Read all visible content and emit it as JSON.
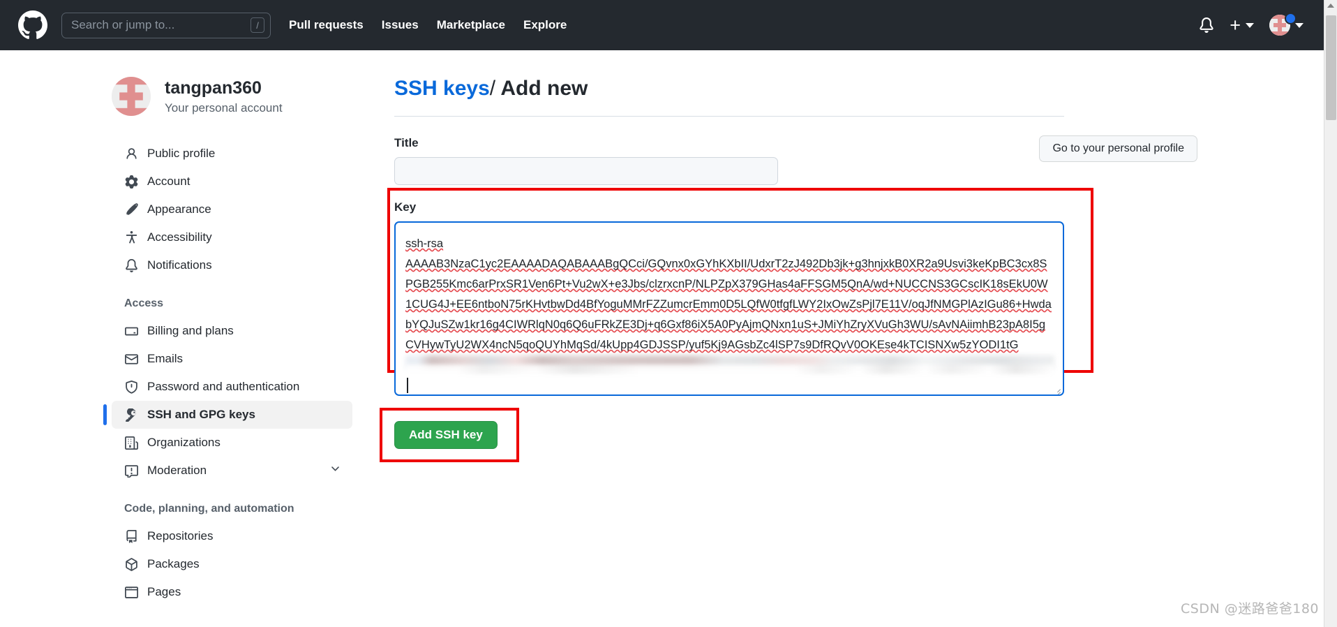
{
  "topbar": {
    "logo_icon": "github-mark-icon",
    "search": {
      "placeholder": "Search or jump to...",
      "value": "",
      "shortcut_key": "/"
    },
    "nav_links": [
      {
        "label": "Pull requests"
      },
      {
        "label": "Issues"
      },
      {
        "label": "Marketplace"
      },
      {
        "label": "Explore"
      }
    ],
    "notifications_icon": "bell-icon",
    "create_new_icon": "plus-icon",
    "create_new_caret": "chevron-down-icon",
    "avatar_icon": "user-avatar-identicon",
    "avatar_caret": "chevron-down-icon",
    "status_dot_color": "#1f6feb",
    "background_color": "#24292f"
  },
  "profile": {
    "avatar_icon": "user-avatar-identicon",
    "name": "tangpan360",
    "subtitle": "Your personal account",
    "go_to_profile_label": "Go to your personal profile"
  },
  "sidebar": {
    "items": [
      {
        "label": "Public profile",
        "icon": "person-icon",
        "active": false
      },
      {
        "label": "Account",
        "icon": "gear-icon",
        "active": false
      },
      {
        "label": "Appearance",
        "icon": "paintbrush-icon",
        "active": false
      },
      {
        "label": "Accessibility",
        "icon": "accessibility-icon",
        "active": false
      },
      {
        "label": "Notifications",
        "icon": "bell-icon",
        "active": false
      }
    ],
    "section_access": {
      "title": "Access",
      "items": [
        {
          "label": "Billing and plans",
          "icon": "credit-card-icon",
          "active": false
        },
        {
          "label": "Emails",
          "icon": "mail-icon",
          "active": false
        },
        {
          "label": "Password and authentication",
          "icon": "shield-icon",
          "active": false
        },
        {
          "label": "SSH and GPG keys",
          "icon": "key-icon",
          "active": true
        },
        {
          "label": "Organizations",
          "icon": "organization-icon",
          "active": false
        },
        {
          "label": "Moderation",
          "icon": "report-icon",
          "active": false,
          "chevron": "chevron-down-icon"
        }
      ]
    },
    "section_code": {
      "title": "Code, planning, and automation",
      "items": [
        {
          "label": "Repositories",
          "icon": "repo-icon",
          "active": false
        },
        {
          "label": "Packages",
          "icon": "package-icon",
          "active": false
        },
        {
          "label": "Pages",
          "icon": "browser-icon",
          "active": false
        }
      ]
    }
  },
  "main": {
    "heading_link": "SSH keys",
    "heading_separator": "/",
    "heading_current": "Add new",
    "title_field": {
      "label": "Title",
      "value": "",
      "placeholder": ""
    },
    "key_field": {
      "label": "Key",
      "lines": [
        "ssh-rsa",
        "AAAAB3NzaC1yc2EAAAADAQABAAABgQCci/GQvnx0xGYhKXbII/UdxrT2zJ492Db3jk+g3hnjxkB0XR2a9Usvi3keKpBC3cx8S",
        "PGB255Kmc6arPrxSR1Ven6Pt+Vu2wX+e3Jbs/clzrxcnP/NLPZpX379GHas4aFFSGM5QnA/wd+NUCCNS3GCscIK18sEkU0W",
        "1CUG4J+EE6ntboN75rKHvtbwDd4BfYoguMMrFZZumcrEmm0D5LQfW0tfgfLWY2IxOwZsPjl7E11V/oqJfNMGPlAzIGu86+H",
        "wdabYQJuSZw1kr16g4CIWRlqN0q6Q6uFRkZE3Dj+q6Gxf86iX5A0PyAjmQNxn1uS+JMiYhZryXVuGh3WU/sAvNAiimhB23p",
        "A8I5gCVHywTyU2WX4ncN5qoQUYhMqSd/4kUpp4GDJSSP/yuf5Kj9AGsbZc4lSP7s9DfRQvV0OKEse4kTCISNXw5zYODI1tG"
      ],
      "redacted_line_note": "blurred",
      "focused": true,
      "border_color": "#0969da"
    },
    "submit_button": {
      "label": "Add SSH key",
      "color": "#2da44e"
    },
    "annotation_color": "#ee0000"
  },
  "watermark": {
    "text": "CSDN @迷路爸爸180"
  }
}
